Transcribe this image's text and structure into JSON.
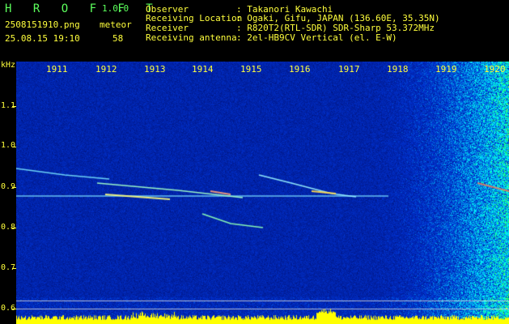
{
  "app": {
    "name": "H R O F F T",
    "version": "1.0.0"
  },
  "file": {
    "name": "2508151910.png",
    "datetime": "25.08.15 19:10"
  },
  "counter": {
    "label": "meteor",
    "value": "58"
  },
  "info": {
    "rows": [
      {
        "label": "Observer",
        "value": ": Takanori Kawachi"
      },
      {
        "label": "Receiving Location",
        "value": ": Ogaki, Gifu, JAPAN (136.60E, 35.35N)"
      },
      {
        "label": "Receiver",
        "value": ": R820T2(RTL-SDR) SDR-Sharp 53.372MHz"
      },
      {
        "label": "Receiving antenna",
        "value": ": 2el-HB9CV Vertical (el. E-W)"
      }
    ]
  },
  "axis": {
    "unit": "kHz",
    "y_ticks": [
      "1.1",
      "1.0",
      "0.9",
      "0.8",
      "0.7",
      "0.6"
    ],
    "x_ticks": [
      "1911",
      "1912",
      "1913",
      "1914",
      "1915",
      "1916",
      "1917",
      "1918",
      "1919",
      "1920"
    ]
  },
  "colors": {
    "background": "#000000",
    "spectrum_base": "#0a1a8c",
    "label_green": "#5cff5c",
    "label_yellow": "#ffff3c"
  }
}
